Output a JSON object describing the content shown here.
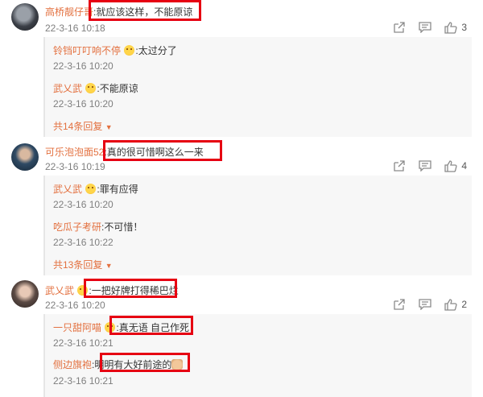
{
  "comments": [
    {
      "user": "高桥靓仔哥",
      "text": ":就应该这样，不能原谅",
      "time": "22-3-16 10:18",
      "likes": "3",
      "replies": [
        {
          "user": "铃铛叮叮响不停",
          "text": ":太过分了",
          "time": "22-3-16 10:20"
        },
        {
          "user": "武乂武",
          "text": ":不能原谅",
          "time": "22-3-16 10:20"
        }
      ],
      "more": "共14条回复"
    },
    {
      "user": "可乐泡泡面52",
      "text": ":真的很可惜啊这么一来",
      "time": "22-3-16 10:19",
      "likes": "4",
      "replies": [
        {
          "user": "武乂武",
          "text": ":罪有应得",
          "time": "22-3-16 10:20"
        },
        {
          "user": "吃瓜子考研",
          "text": ":不可惜！",
          "time": "22-3-16 10:22"
        }
      ],
      "more": "共13条回复"
    },
    {
      "user": "武乂武",
      "text": ":一把好牌打得稀巴烂",
      "time": "22-3-16 10:20",
      "likes": "2",
      "replies": [
        {
          "user": "一只甜阿喵",
          "text": ":真无语 自己作死",
          "time": "22-3-16 10:21"
        },
        {
          "user": "侧边旗袍",
          "text": ":明明有大好前途的",
          "time": "22-3-16 10:21"
        }
      ]
    }
  ],
  "colors": {
    "username": "#e3703f",
    "highlight": "#e60012",
    "time": "#7f7f7f"
  },
  "icons": [
    "share-icon",
    "comment-icon",
    "like-icon",
    "emoji-icon",
    "caret-down-icon"
  ]
}
